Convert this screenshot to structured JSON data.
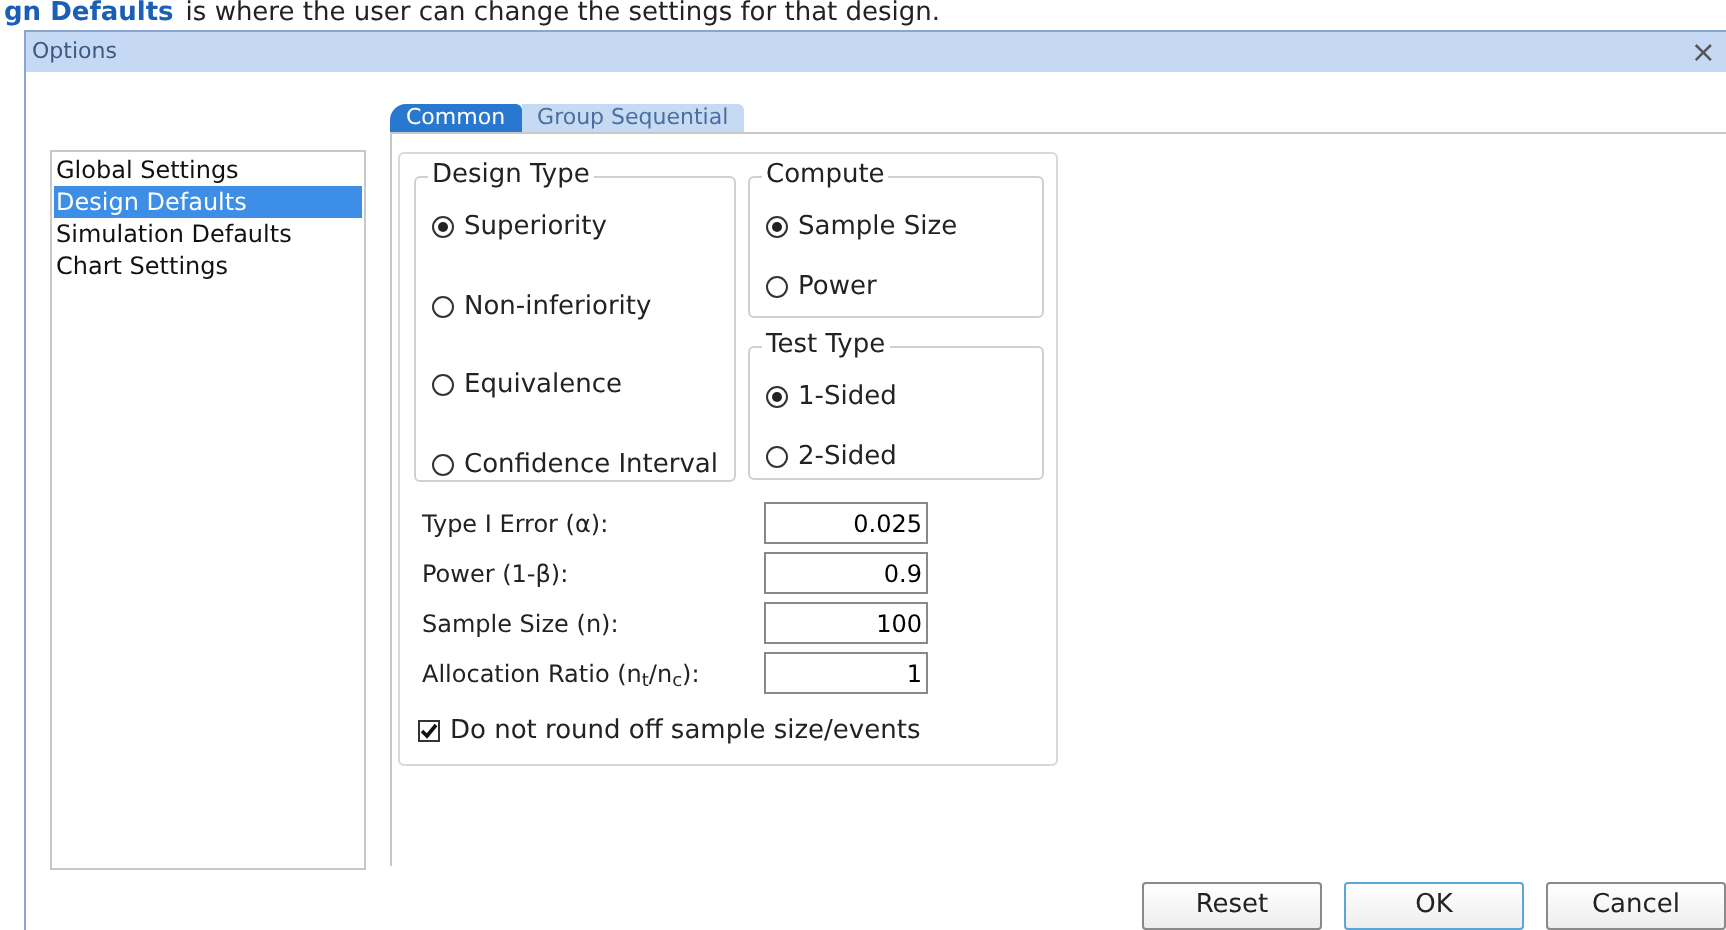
{
  "caption": {
    "link": "gn Defaults",
    "text": "is where the user can change the settings for that design."
  },
  "window": {
    "title": "Options",
    "close": "×"
  },
  "sidebar": {
    "items": [
      {
        "label": "Global Settings",
        "selected": false
      },
      {
        "label": "Design Defaults",
        "selected": true
      },
      {
        "label": "Simulation Defaults",
        "selected": false
      },
      {
        "label": "Chart Settings",
        "selected": false
      }
    ]
  },
  "tabs": [
    {
      "label": "Common",
      "selected": true
    },
    {
      "label": "Group Sequential",
      "selected": false
    }
  ],
  "design_type": {
    "title": "Design Type",
    "options": [
      {
        "label": "Superiority",
        "selected": true
      },
      {
        "label": "Non-inferiority",
        "selected": false
      },
      {
        "label": "Equivalence",
        "selected": false
      },
      {
        "label": "Confidence Interval",
        "selected": false
      }
    ]
  },
  "compute": {
    "title": "Compute",
    "options": [
      {
        "label": "Sample Size",
        "selected": true
      },
      {
        "label": "Power",
        "selected": false
      }
    ]
  },
  "test_type": {
    "title": "Test Type",
    "options": [
      {
        "label": "1-Sided",
        "selected": true
      },
      {
        "label": "2-Sided",
        "selected": false
      }
    ]
  },
  "fields": [
    {
      "label": "Type I Error (α):",
      "value": "0.025"
    },
    {
      "label": "Power (1-β):",
      "value": "0.9"
    },
    {
      "label": "Sample Size (n):",
      "value": "100"
    },
    {
      "label": "Allocation Ratio (n$_{t}$/n$_{c}$):",
      "value": "1"
    }
  ],
  "round_off": {
    "label": "Do not round off sample size/events",
    "checked": true
  },
  "buttons": [
    {
      "label": "Reset",
      "default": false
    },
    {
      "label": "OK",
      "default": true
    },
    {
      "label": "Cancel",
      "default": false
    }
  ]
}
